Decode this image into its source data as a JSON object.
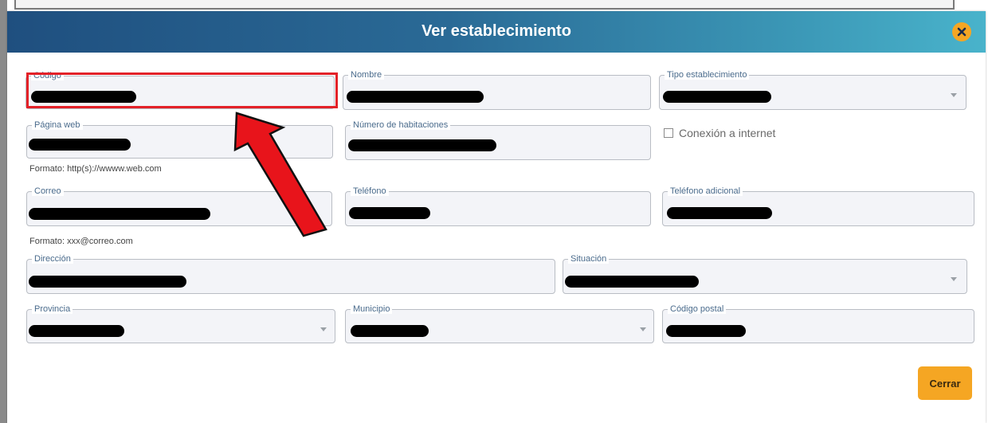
{
  "modal": {
    "title": "Ver establecimiento",
    "close_icon": "close-x-icon",
    "accent_color": "#f5a623",
    "header_gradient": [
      "#1f4f7f",
      "#49b3cb"
    ]
  },
  "fields": {
    "codigo": {
      "label": "Código",
      "value": "[redacted]"
    },
    "nombre": {
      "label": "Nombre",
      "value": "[redacted]"
    },
    "tipo_establecimiento": {
      "label": "Tipo establecimiento",
      "value": "[redacted]"
    },
    "pagina_web": {
      "label": "Página web",
      "value": "[redacted]",
      "hint": "Formato: http(s)://wwww.web.com"
    },
    "numero_habitaciones": {
      "label": "Número de habitaciones",
      "value": "[redacted]"
    },
    "conexion_internet": {
      "label": "Conexión a internet",
      "checked": false
    },
    "correo": {
      "label": "Correo",
      "value": "[redacted]",
      "hint": "Formato: xxx@correo.com"
    },
    "telefono": {
      "label": "Teléfono",
      "value": "[redacted]"
    },
    "telefono_adicional": {
      "label": "Teléfono adicional",
      "value": "[redacted]"
    },
    "direccion": {
      "label": "Dirección",
      "value": "[redacted]"
    },
    "situacion": {
      "label": "Situación",
      "value": "[redacted]"
    },
    "provincia": {
      "label": "Provincia",
      "value": "[redacted]"
    },
    "municipio": {
      "label": "Municipio",
      "value": "[redacted]"
    },
    "codigo_postal": {
      "label": "Código postal",
      "value": "[redacted]"
    }
  },
  "footer": {
    "close_label": "Cerrar"
  },
  "annotation": {
    "highlight_color": "#e32128",
    "arrow_icon": "red-arrow-icon"
  }
}
